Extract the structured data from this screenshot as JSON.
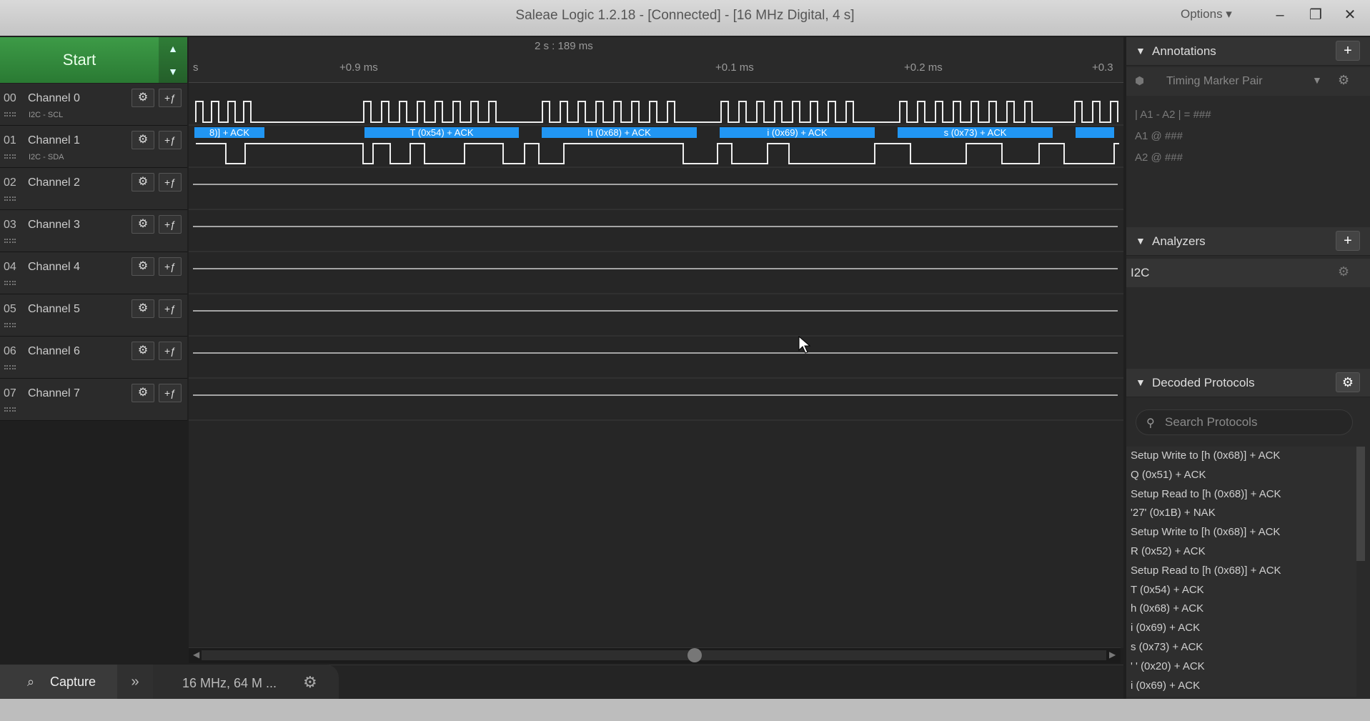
{
  "window": {
    "title": "Saleae Logic 1.2.18 - [Connected] - [16 MHz Digital, 4 s]",
    "options_label": "Options ▾",
    "min_icon": "–",
    "restore_icon": "❐",
    "close_icon": "✕"
  },
  "start": {
    "label": "Start",
    "up_icon": "▲",
    "down_icon": "▼"
  },
  "channels": [
    {
      "num": "00",
      "name": "Channel 0",
      "sub": "I2C - SCL",
      "color": "#8a5a2a"
    },
    {
      "num": "01",
      "name": "Channel 1",
      "sub": "I2C - SDA",
      "color": "#a0522d"
    },
    {
      "num": "02",
      "name": "Channel 2",
      "sub": "",
      "color": "#d32f2f"
    },
    {
      "num": "03",
      "name": "Channel 3",
      "sub": "",
      "color": "#f57c00"
    },
    {
      "num": "04",
      "name": "Channel 4",
      "sub": "",
      "color": "#e6c200"
    },
    {
      "num": "05",
      "name": "Channel 5",
      "sub": "",
      "color": "#43a047"
    },
    {
      "num": "06",
      "name": "Channel 6",
      "sub": "",
      "color": "#3949ab"
    },
    {
      "num": "07",
      "name": "Channel 7",
      "sub": "",
      "color": "#8e24aa"
    }
  ],
  "channel_buttons": {
    "gear_icon": "⚙",
    "trigger_icon": "+ƒ"
  },
  "timeline": {
    "center_time": "2 s : 189 ms",
    "ticks": [
      "s",
      "+0.9 ms",
      "+0.1 ms",
      "+0.2 ms",
      "+0.3"
    ]
  },
  "decode_labels": [
    "8)] + ACK",
    "T (0x54) + ACK",
    "h (0x68) + ACK",
    "i (0x69) + ACK",
    "s (0x73) + ACK"
  ],
  "bottom": {
    "capture_label": "Capture",
    "capture_icon": "⌕",
    "more_icon": "»",
    "sample_label": "16 MHz, 64 M ...",
    "gear_icon": "⚙"
  },
  "annotations": {
    "title": "Annotations",
    "add_icon": "+",
    "marker_label": "Timing Marker Pair",
    "line1": "| A1 - A2 | = ###",
    "line2": "A1  @  ###",
    "line3": "A2  @  ###"
  },
  "analyzers": {
    "title": "Analyzers",
    "add_icon": "+",
    "item": "I2C",
    "gear_icon": "⚙"
  },
  "decoded": {
    "title": "Decoded Protocols",
    "gear_icon": "⚙",
    "search_placeholder": "Search Protocols",
    "items": [
      "Setup Write to [h (0x68)] + ACK",
      "Q (0x51) + ACK",
      "Setup Read to [h (0x68)] + ACK",
      "'27' (0x1B) + NAK",
      "Setup Write to [h (0x68)] + ACK",
      "R (0x52) + ACK",
      "Setup Read to [h (0x68)] + ACK",
      "T (0x54) + ACK",
      "h (0x68) + ACK",
      "i (0x69) + ACK",
      "s (0x73) + ACK",
      "' ' (0x20) + ACK",
      "i (0x69) + ACK"
    ]
  }
}
